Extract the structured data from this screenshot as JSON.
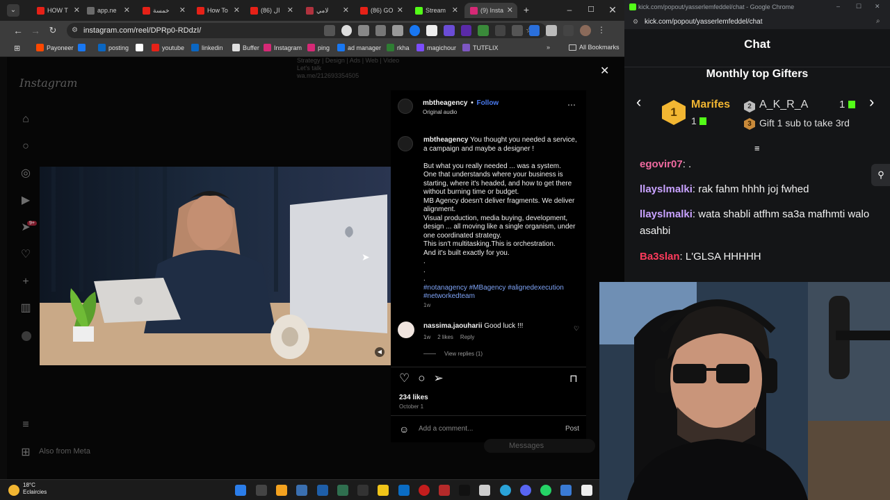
{
  "left_browser": {
    "tabs": [
      {
        "label": "HOW T",
        "color": "#e62117"
      },
      {
        "label": "app.ne",
        "color": "#6b6b6b"
      },
      {
        "label": "خمسة",
        "color": "#e62117"
      },
      {
        "label": "How To",
        "color": "#e62117"
      },
      {
        "label": "(86) ال",
        "color": "#e62117"
      },
      {
        "label": "لامي",
        "color": "#b0323e"
      },
      {
        "label": "(86) GO",
        "color": "#e62117"
      },
      {
        "label": "Stream",
        "color": "#53fc18"
      },
      {
        "label": "(9) Insta",
        "color": "#d62976"
      }
    ],
    "url": "instagram.com/reel/DPRp0-RDdzI/",
    "bookmarks": [
      {
        "label": "Payoneer",
        "color": "#ff4800"
      },
      {
        "label": "",
        "color": "#1877f2"
      },
      {
        "label": "posting",
        "color": "#0a66c2"
      },
      {
        "label": "",
        "color": "#ffffff"
      },
      {
        "label": "youtube",
        "color": "#e62117"
      },
      {
        "label": "linkedin",
        "color": "#0a66c2"
      },
      {
        "label": "Buffer",
        "color": "#e0e0e0"
      },
      {
        "label": "Instagram",
        "color": "#d62976"
      },
      {
        "label": "ping",
        "color": "#d62976"
      },
      {
        "label": "ad manager",
        "color": "#1877f2"
      },
      {
        "label": "rkha",
        "color": "#2e7d32"
      },
      {
        "label": "magichour",
        "color": "#7c4dff"
      },
      {
        "label": "TUTFLIX",
        "color": "#7e57c2"
      }
    ],
    "all_bookmarks": "All Bookmarks"
  },
  "instagram": {
    "logo": "Instagram",
    "top_snippet": [
      "Strategy | Design | Ads | Web | Video",
      "Let's talk",
      "wa.me/212693354505"
    ],
    "sidebar_icons": [
      "home-icon",
      "search-icon",
      "explore-icon",
      "reels-icon",
      "messages-icon",
      "notifications-icon",
      "create-icon",
      "dashboard-icon",
      "profile-avatar"
    ],
    "notification_badge": "9+",
    "more_label": "Also from Meta",
    "messages_label": "Messages",
    "post": {
      "username": "mbtheagency",
      "separator": "•",
      "follow": "Follow",
      "audio": "Original audio",
      "caption_user": "mbtheagency",
      "caption_lines": [
        "You thought you needed a service, a campaign and maybe a designer !",
        "",
        "But what you really needed ... was a system.",
        "One that understands where your business is starting, where it's headed, and how to get there without burning time or budget.",
        "MB Agency doesn't deliver fragments. We deliver alignment.",
        "Visual production, media buying, development, design ... all moving like a single organism, under one coordinated strategy.",
        "This isn't multitasking.This is orchestration.",
        "And it's built exactly for you.",
        ".",
        ".",
        "."
      ],
      "hashtags": "#notanagency #MBagency #alignedexecution #networkedteam",
      "caption_age": "1w",
      "comment": {
        "user": "nassima.jaouharii",
        "text": "Good luck !!!",
        "age": "1w",
        "likes": "2 likes",
        "reply": "Reply",
        "view_replies": "View replies (1)"
      },
      "likes": "234 likes",
      "date": "October 1",
      "comment_placeholder": "Add a comment...",
      "post_button": "Post"
    }
  },
  "kick": {
    "window_title": "kick.com/popout/yasserlemfeddel/chat - Google Chrome",
    "url": "kick.com/popout/yasserlemfeddel/chat",
    "chat_title": "Chat",
    "gifters_title": "Monthly top Gifters",
    "top1_name": "Marifes",
    "top1_count": "1",
    "top2_name": "A_K_R_A",
    "top2_count": "1",
    "top3_text": "Gift 1 sub to take 3rd",
    "messages": [
      {
        "user": "egovir07",
        "text": ".",
        "color": "#f06aa0"
      },
      {
        "user": "llayslmalki",
        "text": "rak fahm hhhh joj fwhed",
        "color": "#c8a2ff"
      },
      {
        "user": "llayslmalki",
        "text": "wata shabli atfhm sa3a mafhmti walo asahbi",
        "color": "#c8a2ff"
      },
      {
        "user": "Ba3slan",
        "text": "L'GLSA HHHHH",
        "color": "#ff3b5c"
      }
    ]
  },
  "taskbar": {
    "temperature": "18°C",
    "weather": "Eclaircies"
  },
  "colors": {
    "ig_blue": "#4a7bf0",
    "hashtag": "#7fa4f7",
    "kick_gold": "#f2b632",
    "kick_green": "#53fc18"
  }
}
